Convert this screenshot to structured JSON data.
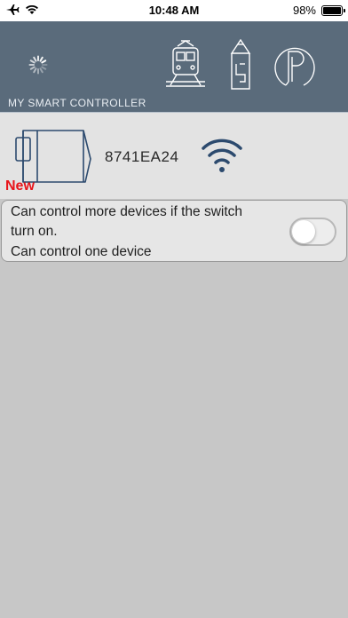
{
  "status_bar": {
    "time": "10:48 AM",
    "battery_percent": "98%",
    "battery_level": 0.98,
    "icons": [
      "airplane-icon",
      "wifi-icon"
    ]
  },
  "header": {
    "background_color": "#5a6b7b",
    "icons": [
      "loading-spinner-icon",
      "train-icon",
      "pencil-icon",
      "parking-icon"
    ],
    "section_label": "MY SMART CONTROLLER"
  },
  "device": {
    "id": "8741EA24",
    "badge": "New",
    "badge_color": "#e8141a",
    "icons": [
      "controller-device-icon",
      "wifi-signal-icon"
    ]
  },
  "option": {
    "line1": "Can control more devices if the switch",
    "line2": "turn on.",
    "line3": "Can control one device",
    "switch_on": false
  }
}
